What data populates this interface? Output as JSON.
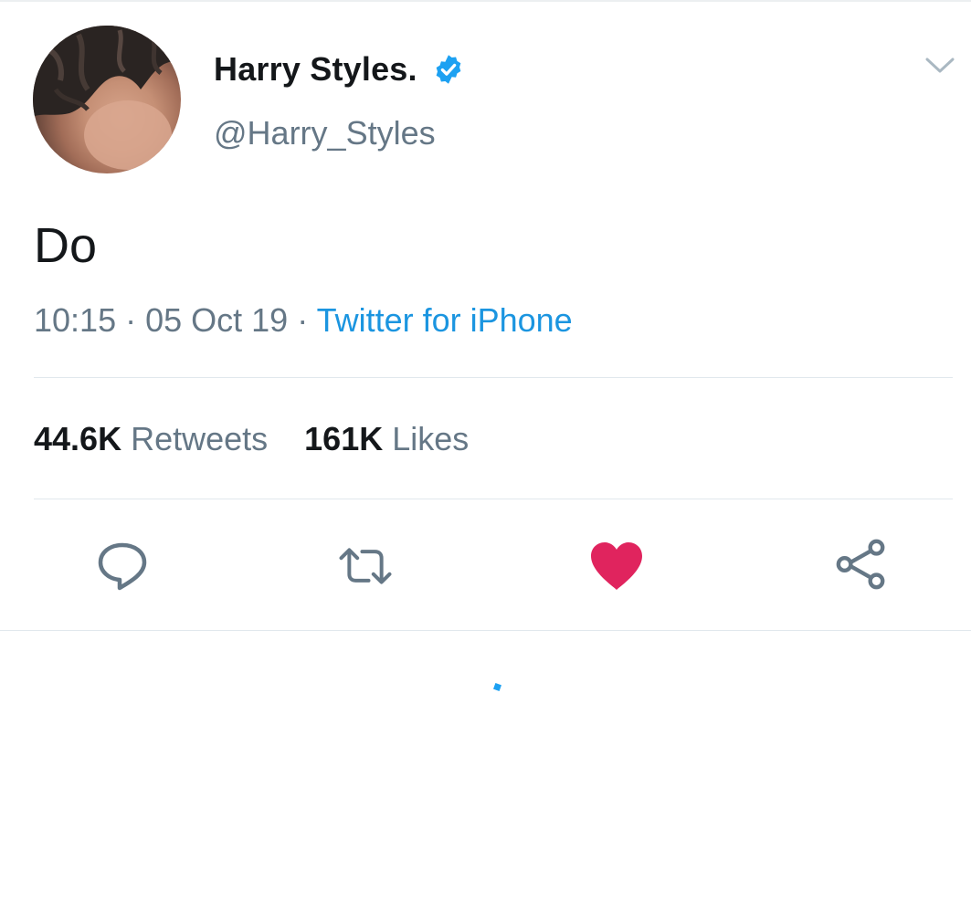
{
  "tweet": {
    "author": {
      "display_name": "Harry Styles.",
      "handle": "@Harry_Styles",
      "verified": true,
      "avatar_icon": "profile-photo"
    },
    "text": "Do",
    "meta": {
      "time": "10:15",
      "separator": "·",
      "date": "05 Oct 19",
      "source": "Twitter for iPhone"
    },
    "stats": {
      "retweets_count": "44.6K",
      "retweets_label": "Retweets",
      "likes_count": "161K",
      "likes_label": "Likes"
    },
    "actions": {
      "reply_icon": "reply-icon",
      "retweet_icon": "retweet-icon",
      "like_icon": "heart-icon",
      "share_icon": "share-icon",
      "liked": true
    }
  },
  "colors": {
    "primary_text": "#14171a",
    "secondary_text": "#657786",
    "link": "#1b95e0",
    "verified": "#1da1f2",
    "like": "#e0245e",
    "divider": "#e1e8ed"
  }
}
